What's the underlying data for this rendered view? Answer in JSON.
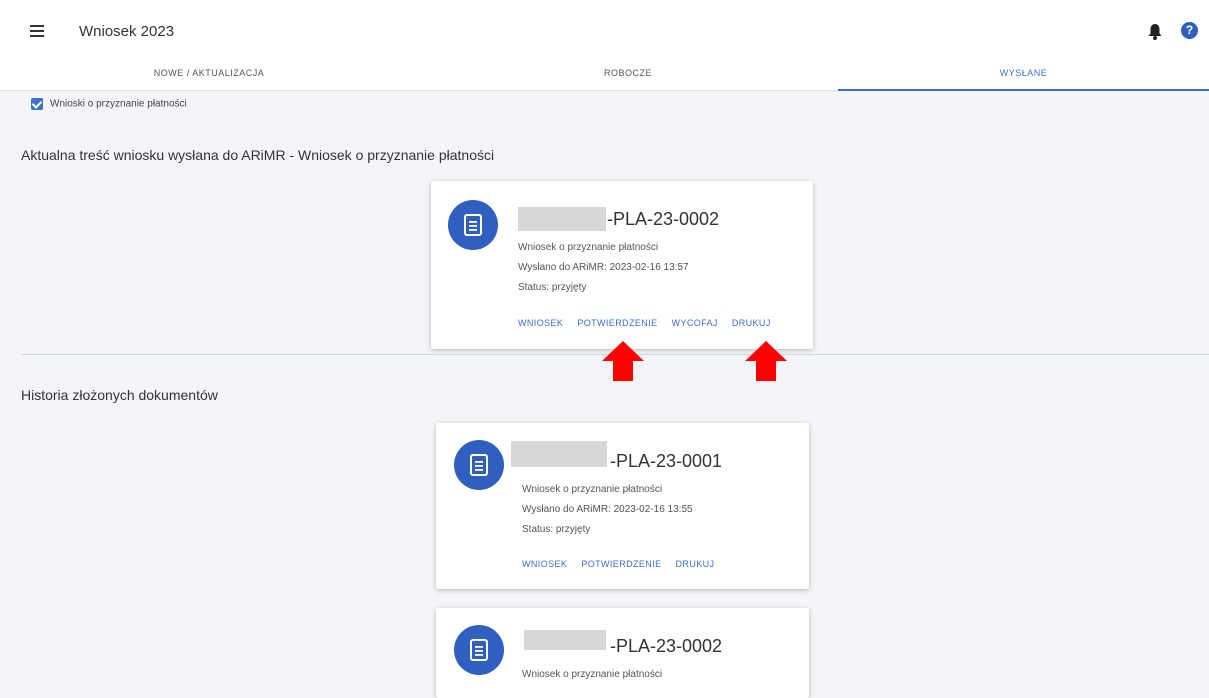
{
  "header": {
    "title": "Wniosek 2023",
    "menu_icon": "hamburger-menu-icon",
    "bell_icon": "bell-icon",
    "help_icon": "help-icon",
    "help_glyph": "?"
  },
  "tabs": [
    {
      "label": "NOWE / AKTUALIZACJA"
    },
    {
      "label": "ROBOCZE"
    },
    {
      "label": "WYSŁANE"
    }
  ],
  "filter": {
    "label": "Wnioski o przyznanie płatności",
    "checked": true
  },
  "current_section": {
    "title": "Aktualna treść wniosku wysłana do ARiMR - Wniosek o przyznanie płatności",
    "card": {
      "id_suffix": "-PLA-23-0002",
      "type": "Wniosek o przyznanie płatności",
      "sent": "Wysłano do ARiMR: 2023-02-16 13:57",
      "status": "Status: przyjęty",
      "actions": [
        "WNIOSEK",
        "POTWIERDZENIE",
        "WYCOFAJ",
        "DRUKUJ"
      ]
    }
  },
  "history_section": {
    "title": "Historia złożonych dokumentów",
    "cards": [
      {
        "id_suffix": "-PLA-23-0001",
        "type": "Wniosek o przyznanie płatności",
        "sent": "Wysłano do ARiMR: 2023-02-16 13:55",
        "status": "Status: przyjęty",
        "actions": [
          "WNIOSEK",
          "POTWIERDZENIE",
          "DRUKUJ"
        ]
      },
      {
        "id_suffix": "-PLA-23-0002",
        "type": "Wniosek o przyznanie płatności"
      }
    ]
  },
  "colors": {
    "accent": "#3b6fcf",
    "doc_circle": "#2f5fc0",
    "arrow": "#ff0000",
    "background": "#f3f5f8"
  }
}
